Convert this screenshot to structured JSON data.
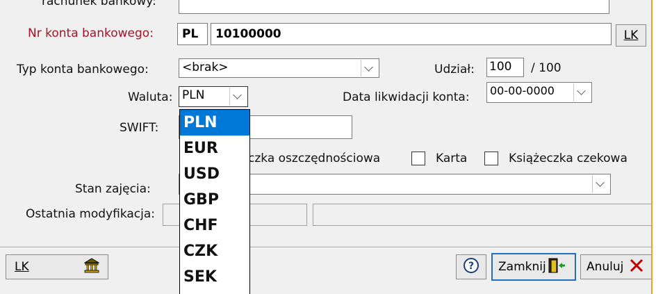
{
  "labels": {
    "account_name": "rachunek bankowy:",
    "account_number": "Nr konta bankowego:",
    "account_type": "Typ konta bankowego:",
    "share": "Udział:",
    "currency": "Waluta:",
    "liquidation_date": "Data likwidacji konta:",
    "swift": "SWIFT:",
    "state": "Stan zajęcia:",
    "last_mod": "Ostatnia modyfikacja:"
  },
  "values": {
    "country": "PL",
    "account_number": "10100000",
    "account_type": "<brak>",
    "share": "100",
    "share_total": "/ 100",
    "currency": "PLN",
    "liquidation_date": "00-00-0000"
  },
  "checkboxes": {
    "savings": "czka oszczędnościowa",
    "card": "Karta",
    "cheque": "Książeczka czekowa"
  },
  "buttons": {
    "lk": "LK",
    "lk_bottom": "LK",
    "close": "Zamknij",
    "cancel": "Anuluj"
  },
  "currency_options": [
    "PLN",
    "EUR",
    "USD",
    "GBP",
    "CHF",
    "CZK",
    "SEK"
  ],
  "colors": {
    "accent": "#0078d7",
    "label_red": "#a0152a",
    "border_orange": "#f0a030"
  }
}
